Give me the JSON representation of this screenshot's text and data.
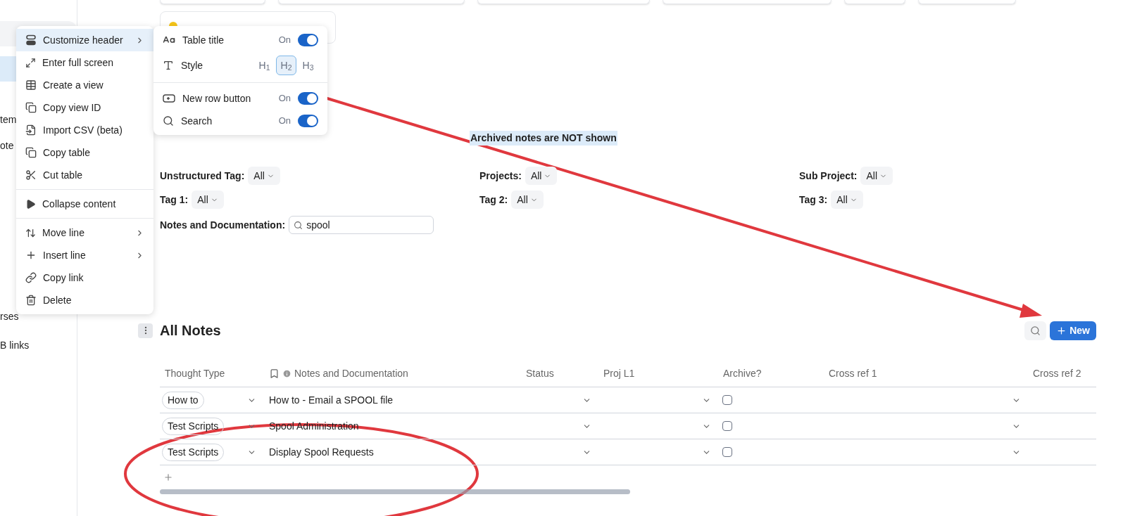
{
  "sidebar": {
    "items": [
      {
        "label": "tem"
      },
      {
        "label": "ote"
      },
      {
        "label": "rses"
      },
      {
        "label": "B links"
      }
    ]
  },
  "context_menu": {
    "groups": [
      [
        {
          "label": "Customize header",
          "submenu": true,
          "selected": true
        },
        {
          "label": "Enter full screen",
          "submenu": false,
          "selected": false
        },
        {
          "label": "Create a view",
          "submenu": false,
          "selected": false
        },
        {
          "label": "Copy view ID",
          "submenu": false,
          "selected": false
        },
        {
          "label": "Import CSV (beta)",
          "submenu": false,
          "selected": false
        },
        {
          "label": "Copy table",
          "submenu": false,
          "selected": false
        },
        {
          "label": "Cut table",
          "submenu": false,
          "selected": false
        }
      ],
      [
        {
          "label": "Collapse content",
          "submenu": false,
          "selected": false
        }
      ],
      [
        {
          "label": "Move line",
          "submenu": true,
          "selected": false
        },
        {
          "label": "Insert line",
          "submenu": true,
          "selected": false
        },
        {
          "label": "Copy link",
          "submenu": false,
          "selected": false
        },
        {
          "label": "Delete",
          "submenu": false,
          "selected": false
        }
      ]
    ]
  },
  "header_submenu": {
    "groups": [
      [
        {
          "kind": "toggle",
          "label": "Table title",
          "state_label": "On",
          "on": true
        },
        {
          "kind": "style",
          "label": "Style",
          "options": [
            {
              "label": "H$_{1}$",
              "selected": false
            },
            {
              "label": "H$_{2}$",
              "selected": true
            },
            {
              "label": "H$_{3}$",
              "selected": false
            }
          ]
        }
      ],
      [
        {
          "kind": "toggle",
          "label": "New row button",
          "state_label": "On",
          "on": true
        },
        {
          "kind": "toggle",
          "label": "Search",
          "state_label": "On",
          "on": true
        }
      ]
    ]
  },
  "notice": "Archived notes are NOT shown",
  "filters": [
    [
      {
        "label": "Unstructured Tag:",
        "value": "All"
      },
      {
        "label": "Projects:",
        "value": "All"
      },
      {
        "label": "Sub Project:",
        "value": "All"
      }
    ],
    [
      {
        "label": "Tag 1:",
        "value": "All"
      },
      {
        "label": "Tag 2:",
        "value": "All"
      },
      {
        "label": "Tag 3:",
        "value": "All"
      }
    ]
  ],
  "search_filter": {
    "label": "Notes and Documentation:",
    "value": "spool"
  },
  "table": {
    "title": "All Notes",
    "new_button": "New",
    "columns": [
      "Thought Type",
      "Notes and Documentation",
      "Status",
      "Proj L1",
      "Archive?",
      "Cross ref 1",
      "Cross ref 2"
    ],
    "rows": [
      {
        "thought_type": "How to",
        "notes": "How to - Email a SPOOL file",
        "archive": false
      },
      {
        "thought_type": "Test Scripts",
        "notes": "Spool Administration",
        "archive": false
      },
      {
        "thought_type": "Test Scripts",
        "notes": "Display Spool Requests",
        "archive": false
      }
    ]
  }
}
